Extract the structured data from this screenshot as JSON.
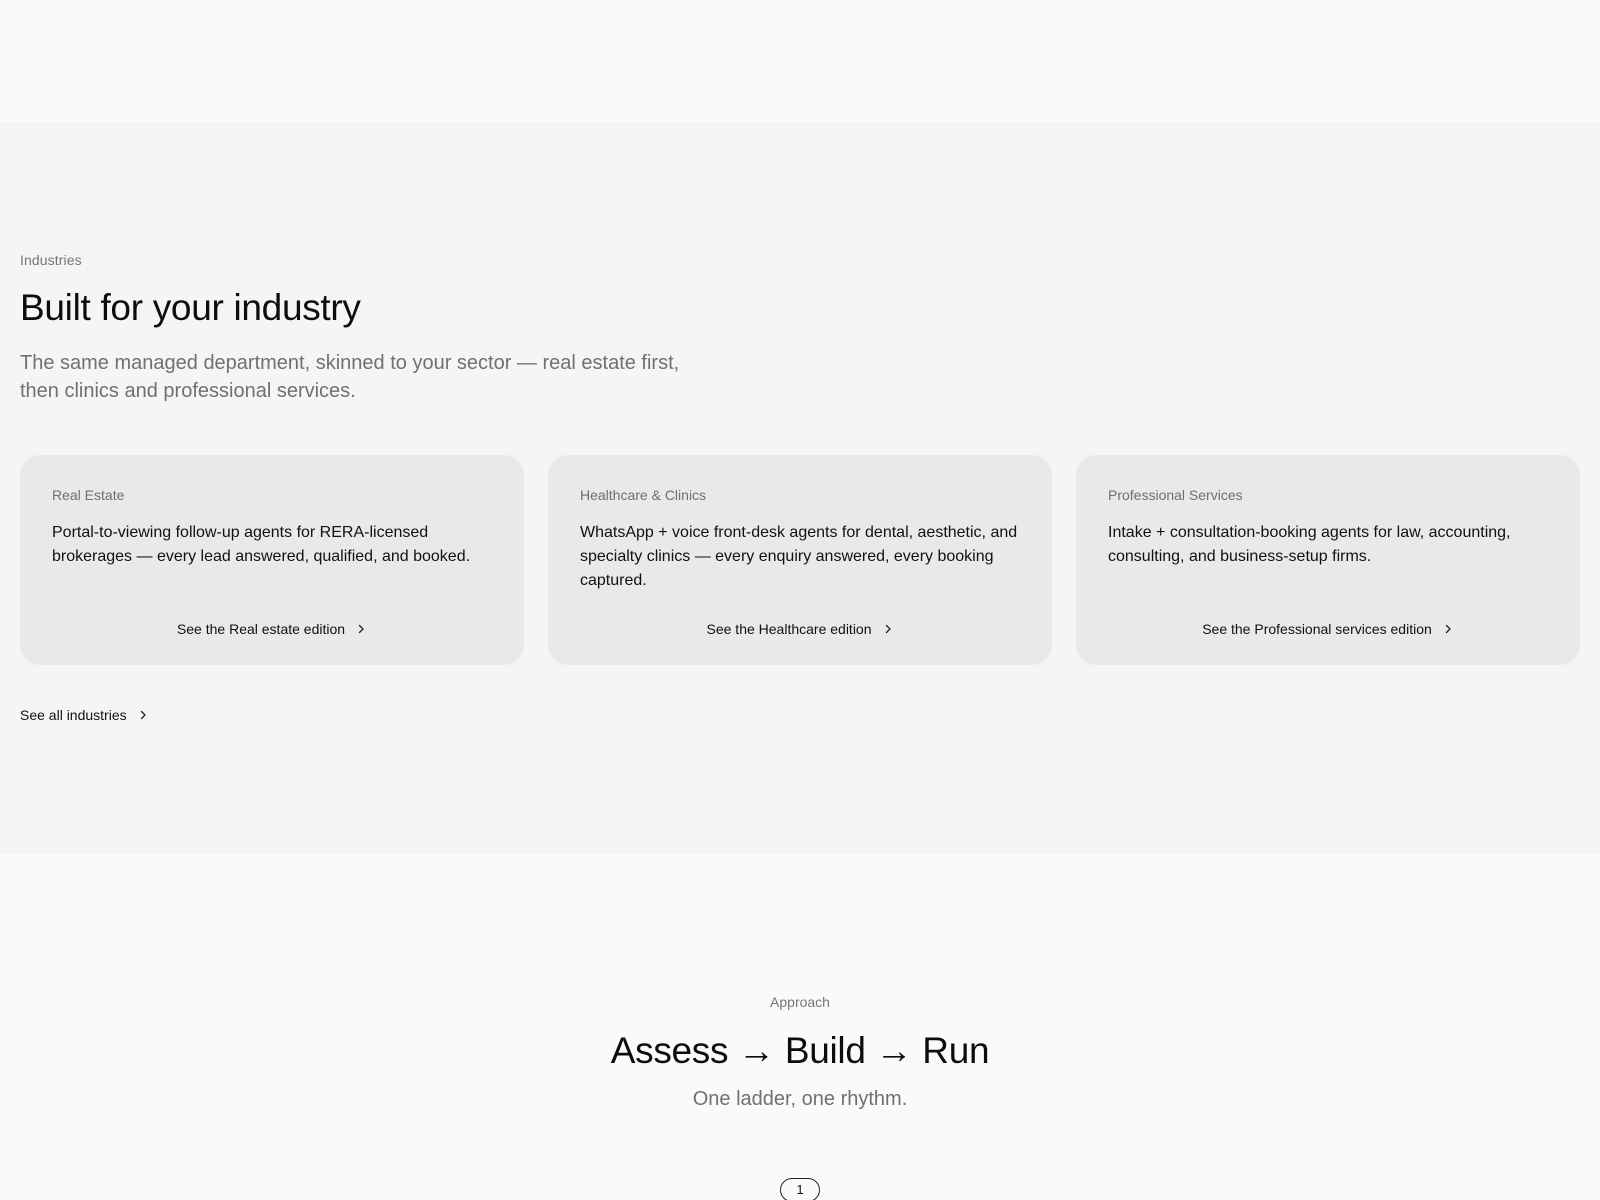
{
  "industries": {
    "eyebrow": "Industries",
    "title": "Built for your industry",
    "subtitle": "The same managed department, skinned to your sector — real estate first, then clinics and professional services.",
    "cards": [
      {
        "eyebrow": "Real Estate",
        "text": "Portal-to-viewing follow-up agents for RERA-licensed brokerages — every lead answered, qualified, and booked.",
        "link": "See the Real estate edition"
      },
      {
        "eyebrow": "Healthcare & Clinics",
        "text": "WhatsApp + voice front-desk agents for dental, aesthetic, and specialty clinics — every enquiry answered, every booking captured.",
        "link": "See the Healthcare edition"
      },
      {
        "eyebrow": "Professional Services",
        "text": "Intake + consultation-booking agents for law, accounting, consulting, and business-setup firms.",
        "link": "See the Professional services edition"
      }
    ],
    "all_link": "See all industries"
  },
  "approach": {
    "eyebrow": "Approach",
    "title": "Assess → Build → Run",
    "subtitle": "One ladder, one rhythm.",
    "step": "1"
  },
  "icons": {
    "chevron": "chevron-right-icon"
  }
}
